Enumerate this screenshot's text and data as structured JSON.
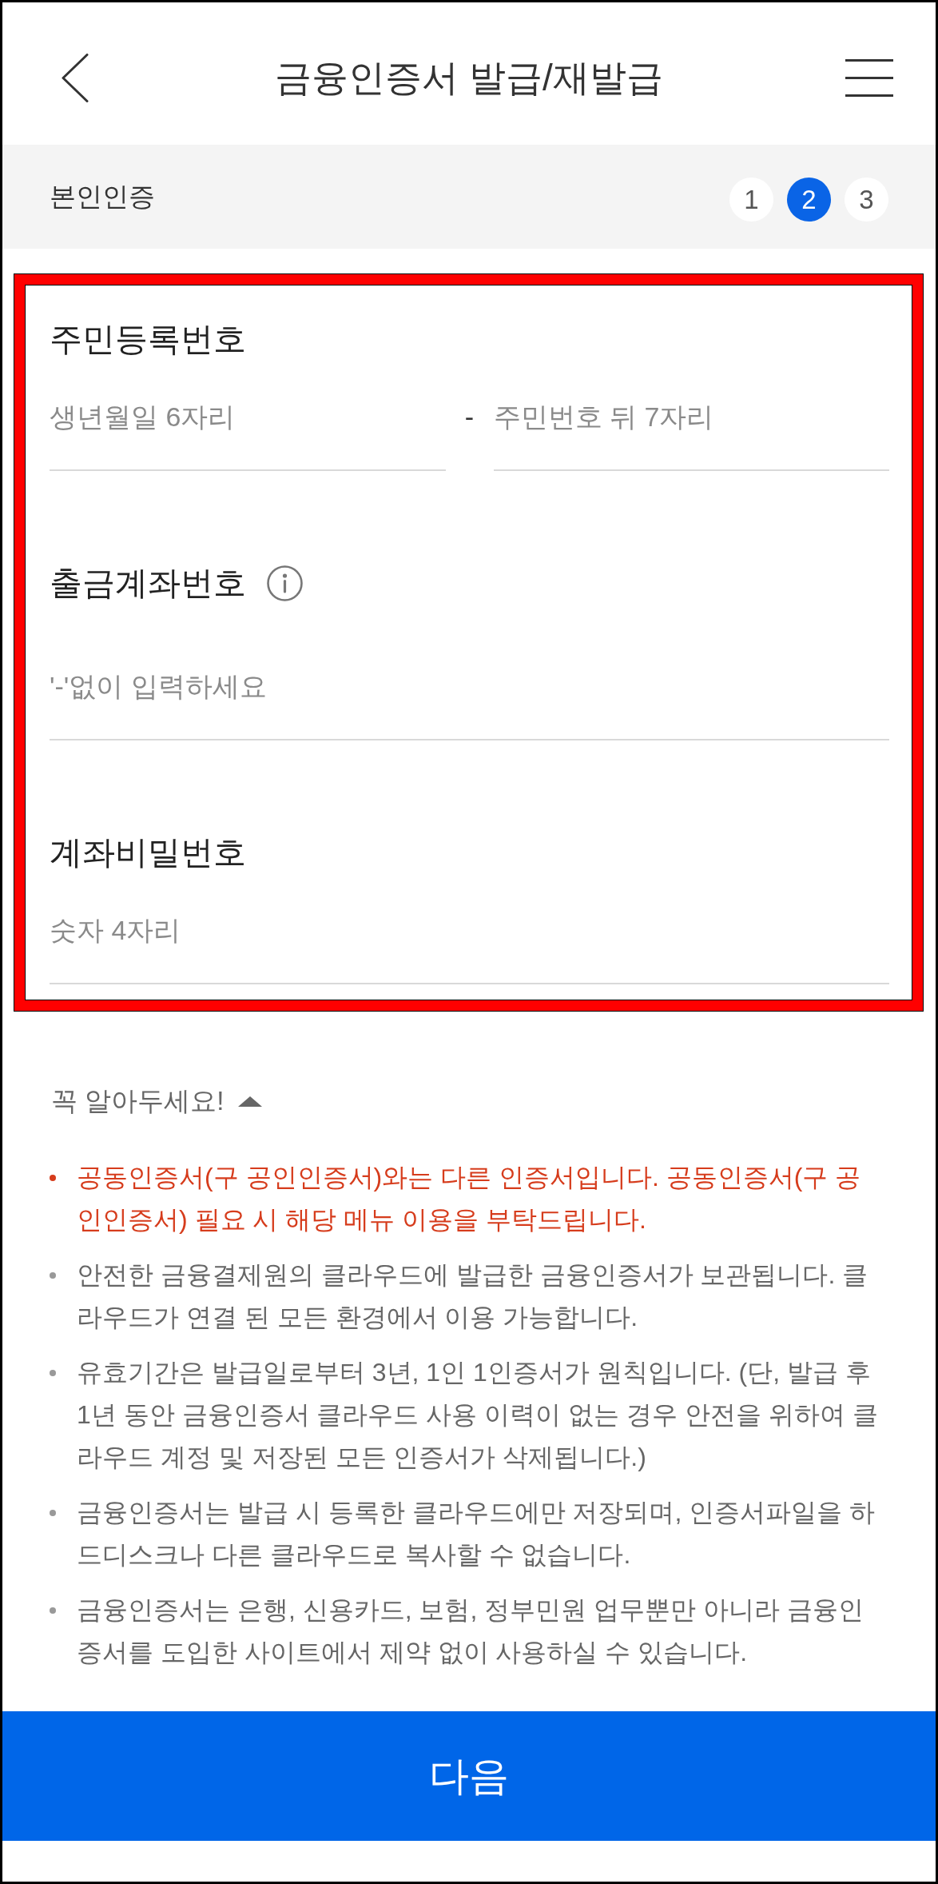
{
  "header": {
    "title": "금융인증서 발급/재발급"
  },
  "step_bar": {
    "title": "본인인증",
    "steps": [
      {
        "label": "1",
        "selected": false
      },
      {
        "label": "2",
        "selected": true
      },
      {
        "label": "3",
        "selected": false
      }
    ]
  },
  "form": {
    "fields": [
      {
        "kind": "split",
        "label": "주민등록번호",
        "info": false,
        "inputs": [
          {
            "placeholder": "생년월일 6자리"
          },
          {
            "placeholder": "주민번호 뒤 7자리"
          }
        ],
        "separator": "-"
      },
      {
        "kind": "single",
        "label": "출금계좌번호",
        "info": true,
        "placeholder": "'-'없이 입력하세요"
      },
      {
        "kind": "single",
        "label": "계좌비밀번호",
        "info": false,
        "placeholder": "숫자 4자리"
      }
    ]
  },
  "notice": {
    "title": "꼭 알아두세요!",
    "expanded": true,
    "items": [
      {
        "text": "공동인증서(구 공인인증서)와는 다른 인증서입니다. 공동인증서(구 공인인증서) 필요 시 해당 메뉴 이용을 부탁드립니다.",
        "highlighted": true
      },
      {
        "text": "안전한 금융결제원의 클라우드에 발급한 금융인증서가 보관됩니다. 클라우드가 연결 된 모든 환경에서 이용 가능합니다.",
        "highlighted": false
      },
      {
        "text": "유효기간은 발급일로부터 3년, 1인 1인증서가 원칙입니다. (단, 발급 후 1년 동안 금융인증서 클라우드 사용 이력이 없는 경우 안전을 위하여 클라우드 계정 및 저장된 모든 인증서가 삭제됩니다.)",
        "highlighted": false
      },
      {
        "text": "금융인증서는 발급 시 등록한 클라우드에만 저장되며, 인증서파일을 하드디스크나 다른 클라우드로 복사할 수 없습니다.",
        "highlighted": false
      },
      {
        "text": "금융인증서는 은행, 신용카드, 보험, 정부민원 업무뿐만 아니라 금융인증서를 도입한 사이트에서 제약 없이 사용하실 수 있습니다.",
        "highlighted": false
      }
    ]
  },
  "next_button": {
    "label": "다음"
  }
}
